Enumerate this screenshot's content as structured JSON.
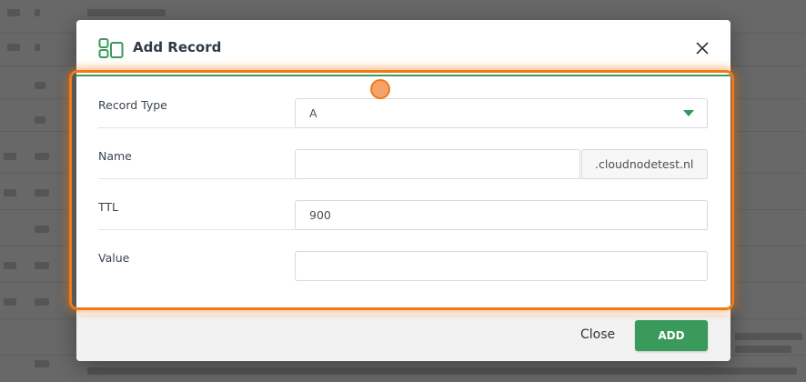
{
  "modal": {
    "title": "Add Record",
    "header_icon": "dns-records-icon",
    "close_icon": "close-icon",
    "accent_color": "#3a9a5b"
  },
  "form": {
    "record_type": {
      "label": "Record Type",
      "value": "A"
    },
    "name": {
      "label": "Name",
      "value": "",
      "suffix": ".cloudnodetest.nl"
    },
    "ttl": {
      "label": "TTL",
      "value": "900"
    },
    "value": {
      "label": "Value",
      "value": ""
    }
  },
  "footer": {
    "close_label": "Close",
    "add_label": "ADD"
  },
  "annotation": {
    "highlight_color": "#f07a18"
  }
}
